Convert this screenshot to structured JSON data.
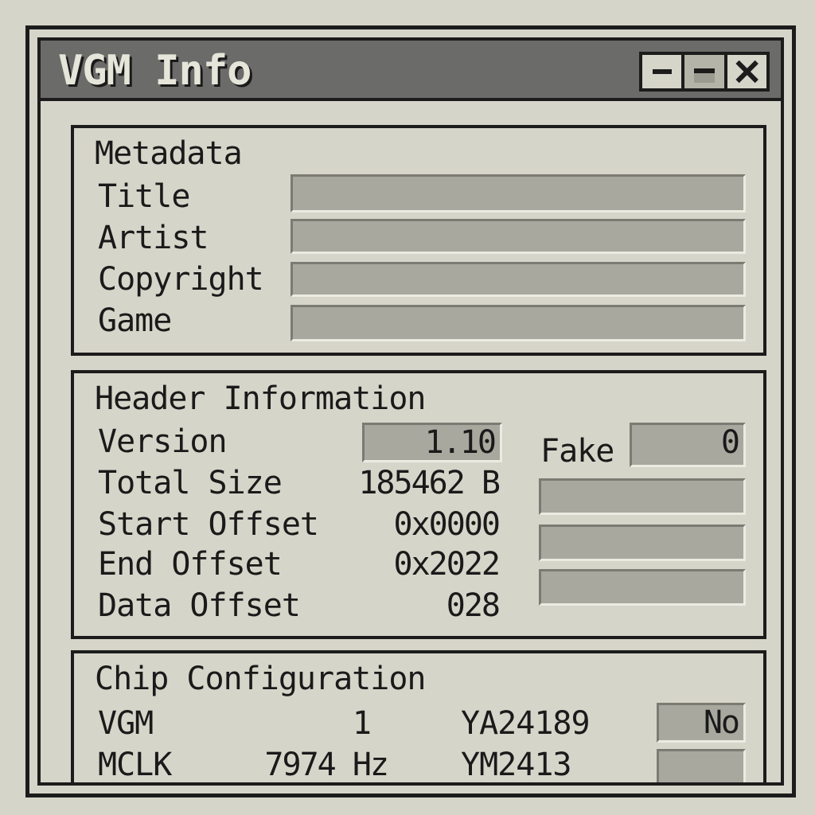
{
  "window": {
    "title": "VGM Info"
  },
  "metadata": {
    "section_title": "Metadata",
    "fields": [
      {
        "label": "Title",
        "value": ""
      },
      {
        "label": "Artist",
        "value": ""
      },
      {
        "label": "Copyright",
        "value": ""
      },
      {
        "label": "Game",
        "value": ""
      }
    ]
  },
  "header_info": {
    "section_title": "Header Information",
    "version_label": "Version",
    "version_value": "1.10",
    "total_size_label": "Total Size",
    "total_size_value": "185462 B",
    "start_offset_label": "Start Offset",
    "start_offset_value": "0x0000",
    "end_offset_label": "End Offset",
    "end_offset_value": "0x2022",
    "data_offset_label": "Data Offset",
    "data_offset_value": "028",
    "fake_label": "Fake",
    "fake_value": "0",
    "extra_fields": [
      "",
      "",
      ""
    ]
  },
  "chip_config": {
    "section_title": "Chip Configuration",
    "vgm_label": "VGM",
    "vgm_value": "1",
    "mclk_label": "MCLK",
    "mclk_value": "7974 Hz",
    "chip1_label": "YA24189",
    "chip1_value": "No",
    "chip2_label": "YM2413",
    "chip2_value": ""
  },
  "colors": {
    "background": "#d6d5c9",
    "title_bar": "#6b6b69",
    "field": "#a9a89f",
    "border": "#1c1c1c"
  },
  "icons": {
    "minimize": "minimize-icon",
    "maximize": "maximize-icon",
    "close": "close-icon"
  }
}
